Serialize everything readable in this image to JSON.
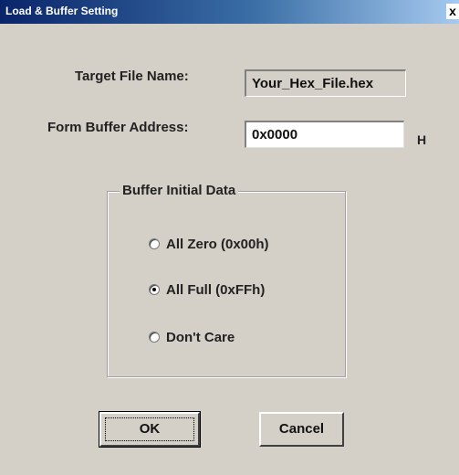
{
  "window": {
    "title": "Load & Buffer Setting",
    "close_glyph": "x"
  },
  "target_file": {
    "label": "Target File Name:",
    "value": "Your_Hex_File.hex"
  },
  "buffer_address": {
    "label": "Form Buffer Address:",
    "value": "0x0000",
    "suffix": "H"
  },
  "initial_data": {
    "group_title": "Buffer Initial Data",
    "options": [
      {
        "label": "All Zero (0x00h)",
        "checked": false
      },
      {
        "label": "All Full (0xFFh)",
        "checked": true
      },
      {
        "label": "Don't Care",
        "checked": false
      }
    ]
  },
  "buttons": {
    "ok_label": "OK",
    "cancel_label": "Cancel"
  },
  "colors": {
    "dialog_bg": "#d4d0c8",
    "titlebar_start": "#0a246a",
    "titlebar_end": "#a6caf0"
  }
}
